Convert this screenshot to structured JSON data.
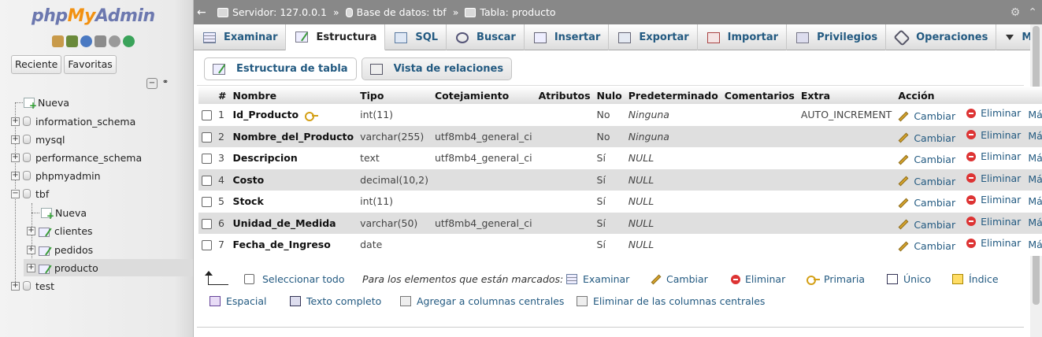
{
  "nav": {
    "logo": {
      "php": "php",
      "my": "My",
      "admin": "Admin"
    },
    "tabs": [
      "Reciente",
      "Favoritas"
    ],
    "tree": [
      {
        "label": "Nueva",
        "type": "new"
      },
      {
        "label": "information_schema",
        "type": "db"
      },
      {
        "label": "mysql",
        "type": "db"
      },
      {
        "label": "performance_schema",
        "type": "db"
      },
      {
        "label": "phpmyadmin",
        "type": "db"
      },
      {
        "label": "tbf",
        "type": "db"
      },
      {
        "label": "Nueva",
        "type": "new-table"
      },
      {
        "label": "clientes",
        "type": "table"
      },
      {
        "label": "pedidos",
        "type": "table"
      },
      {
        "label": "producto",
        "type": "table"
      },
      {
        "label": "test",
        "type": "db"
      }
    ]
  },
  "breadcrumb": {
    "server": "Servidor: 127.0.0.1",
    "database": "Base de datos: tbf",
    "table": "Tabla: producto",
    "sep": "»"
  },
  "menu": {
    "tabs": [
      "Examinar",
      "Estructura",
      "SQL",
      "Buscar",
      "Insertar",
      "Exportar",
      "Importar",
      "Privilegios",
      "Operaciones",
      "Más"
    ],
    "active": "Estructura"
  },
  "subtabs": {
    "structure": "Estructura de tabla",
    "relations": "Vista de relaciones"
  },
  "table": {
    "headers": [
      "#",
      "Nombre",
      "Tipo",
      "Cotejamiento",
      "Atributos",
      "Nulo",
      "Predeterminado",
      "Comentarios",
      "Extra",
      "Acción"
    ],
    "rows": [
      {
        "n": "1",
        "name": "Id_Producto",
        "type": "int(11)",
        "collation": "",
        "attrs": "",
        "null": "No",
        "default": "Ninguna",
        "comments": "",
        "extra": "AUTO_INCREMENT",
        "primary": true
      },
      {
        "n": "2",
        "name": "Nombre_del_Producto",
        "type": "varchar(255)",
        "collation": "utf8mb4_general_ci",
        "attrs": "",
        "null": "No",
        "default": "Ninguna",
        "comments": "",
        "extra": ""
      },
      {
        "n": "3",
        "name": "Descripcion",
        "type": "text",
        "collation": "utf8mb4_general_ci",
        "attrs": "",
        "null": "Sí",
        "default": "NULL",
        "comments": "",
        "extra": ""
      },
      {
        "n": "4",
        "name": "Costo",
        "type": "decimal(10,2)",
        "collation": "",
        "attrs": "",
        "null": "Sí",
        "default": "NULL",
        "comments": "",
        "extra": ""
      },
      {
        "n": "5",
        "name": "Stock",
        "type": "int(11)",
        "collation": "",
        "attrs": "",
        "null": "Sí",
        "default": "NULL",
        "comments": "",
        "extra": ""
      },
      {
        "n": "6",
        "name": "Unidad_de_Medida",
        "type": "varchar(50)",
        "collation": "utf8mb4_general_ci",
        "attrs": "",
        "null": "Sí",
        "default": "NULL",
        "comments": "",
        "extra": ""
      },
      {
        "n": "7",
        "name": "Fecha_de_Ingreso",
        "type": "date",
        "collation": "",
        "attrs": "",
        "null": "Sí",
        "default": "NULL",
        "comments": "",
        "extra": ""
      }
    ],
    "actions": {
      "change": "Cambiar",
      "drop": "Eliminar",
      "more": "Más"
    }
  },
  "bulk": {
    "select_all": "Seleccionar todo",
    "with_selected": "Para los elementos que están marcados:",
    "browse": "Examinar",
    "change": "Cambiar",
    "drop": "Eliminar",
    "primary": "Primaria",
    "unique": "Único",
    "index": "Índice",
    "spatial": "Espacial",
    "fulltext": "Texto completo",
    "add_central": "Agregar a columnas centrales",
    "remove_central": "Eliminar de las columnas centrales"
  },
  "colors": {
    "link": "#235a81",
    "topbar": "#888888",
    "row_alt": "#dfdfdf"
  }
}
